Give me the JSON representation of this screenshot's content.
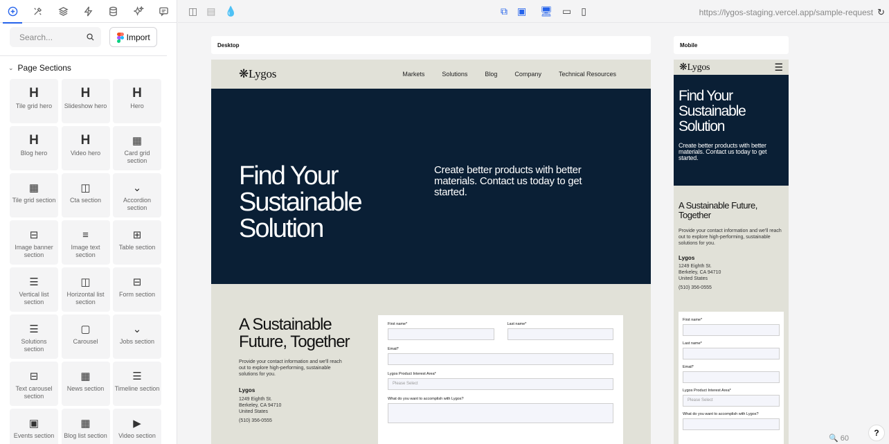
{
  "sidebar": {
    "tabs": [
      {
        "icon": "add-circle-icon"
      },
      {
        "icon": "tools-icon"
      },
      {
        "icon": "layers-icon"
      },
      {
        "icon": "bolt-icon"
      },
      {
        "icon": "database-icon"
      },
      {
        "icon": "sparkle-icon"
      },
      {
        "icon": "comment-icon"
      }
    ],
    "search_placeholder": "Search...",
    "import_label": "Import",
    "section_title": "Page Sections",
    "components": [
      {
        "label": "Tile grid hero",
        "icon": "H"
      },
      {
        "label": "Slideshow hero",
        "icon": "H"
      },
      {
        "label": "Hero",
        "icon": "H"
      },
      {
        "label": "Blog hero",
        "icon": "H"
      },
      {
        "label": "Video hero",
        "icon": "H"
      },
      {
        "label": "Card grid section",
        "icon": "▦"
      },
      {
        "label": "Tile grid section",
        "icon": "▦"
      },
      {
        "label": "Cta section",
        "icon": "◫"
      },
      {
        "label": "Accordion section",
        "icon": "⌄"
      },
      {
        "label": "Image banner section",
        "icon": "⊟"
      },
      {
        "label": "Image text section",
        "icon": "≡"
      },
      {
        "label": "Table section",
        "icon": "⊞"
      },
      {
        "label": "Vertical list section",
        "icon": "☰"
      },
      {
        "label": "Horizontal list section",
        "icon": "◫"
      },
      {
        "label": "Form section",
        "icon": "⊟"
      },
      {
        "label": "Solutions section",
        "icon": "☰"
      },
      {
        "label": "Carousel",
        "icon": "▢"
      },
      {
        "label": "Jobs section",
        "icon": "⌄"
      },
      {
        "label": "Text carousel section",
        "icon": "⊟"
      },
      {
        "label": "News section",
        "icon": "▦"
      },
      {
        "label": "Timeline section",
        "icon": "☰"
      },
      {
        "label": "Events section",
        "icon": "▣"
      },
      {
        "label": "Blog list section",
        "icon": "▦"
      },
      {
        "label": "Video section",
        "icon": "▶"
      }
    ]
  },
  "topbar": {
    "url": "https://lygos-staging.vercel.app/sample-request"
  },
  "frames": {
    "desktop_label": "Desktop",
    "mobile_label": "Mobile"
  },
  "site": {
    "logo": "Lygos",
    "nav": [
      "Markets",
      "Solutions",
      "Blog",
      "Company",
      "Technical Resources"
    ],
    "hero_title": "Find Your Sustainable Solution",
    "hero_text": "Create better products with better materials. Contact us today to get started.",
    "contact_title": "A Sustainable Future, Together",
    "contact_text": "Provide your contact information and we'll reach out to explore high-performing, sustainable solutions for you.",
    "company": "Lygos",
    "address1": "1249 Eighth St.",
    "address2": "Berkeley, CA 94710",
    "address3": "United States",
    "phone": "(510) 356-0555",
    "form": {
      "first_name": "First name*",
      "last_name": "Last name*",
      "email": "Email*",
      "interest": "Lygos Product Interest Area*",
      "interest_placeholder": "Please Select",
      "accomplish": "What do you want to accomplish with Lygos?"
    }
  },
  "status": {
    "zoom": "60",
    "help": "?"
  }
}
